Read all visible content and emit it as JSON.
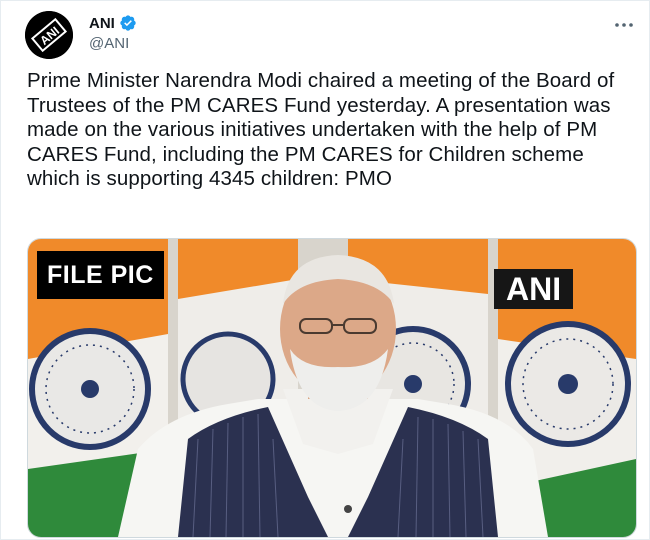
{
  "tweet": {
    "display_name": "ANI",
    "handle": "@ANI",
    "avatar_text": "ANI",
    "text": "Prime Minister Narendra Modi chaired a meeting of the Board of Trustees of the PM CARES Fund yesterday. A presentation was made on the various initiatives undertaken with the help of PM CARES Fund, including the PM CARES for Children scheme which is supporting 4345 children: PMO",
    "more_icon": "more-horizontal-icon",
    "verified_icon": "verified-badge-icon"
  },
  "media": {
    "file_pic_label": "FILE PIC",
    "watermark": "ANI"
  },
  "colors": {
    "verified_blue": "#1d9bf0",
    "saffron": "#f08a2a",
    "india_green": "#2f8a3b",
    "chakra_navy": "#283a6a"
  }
}
